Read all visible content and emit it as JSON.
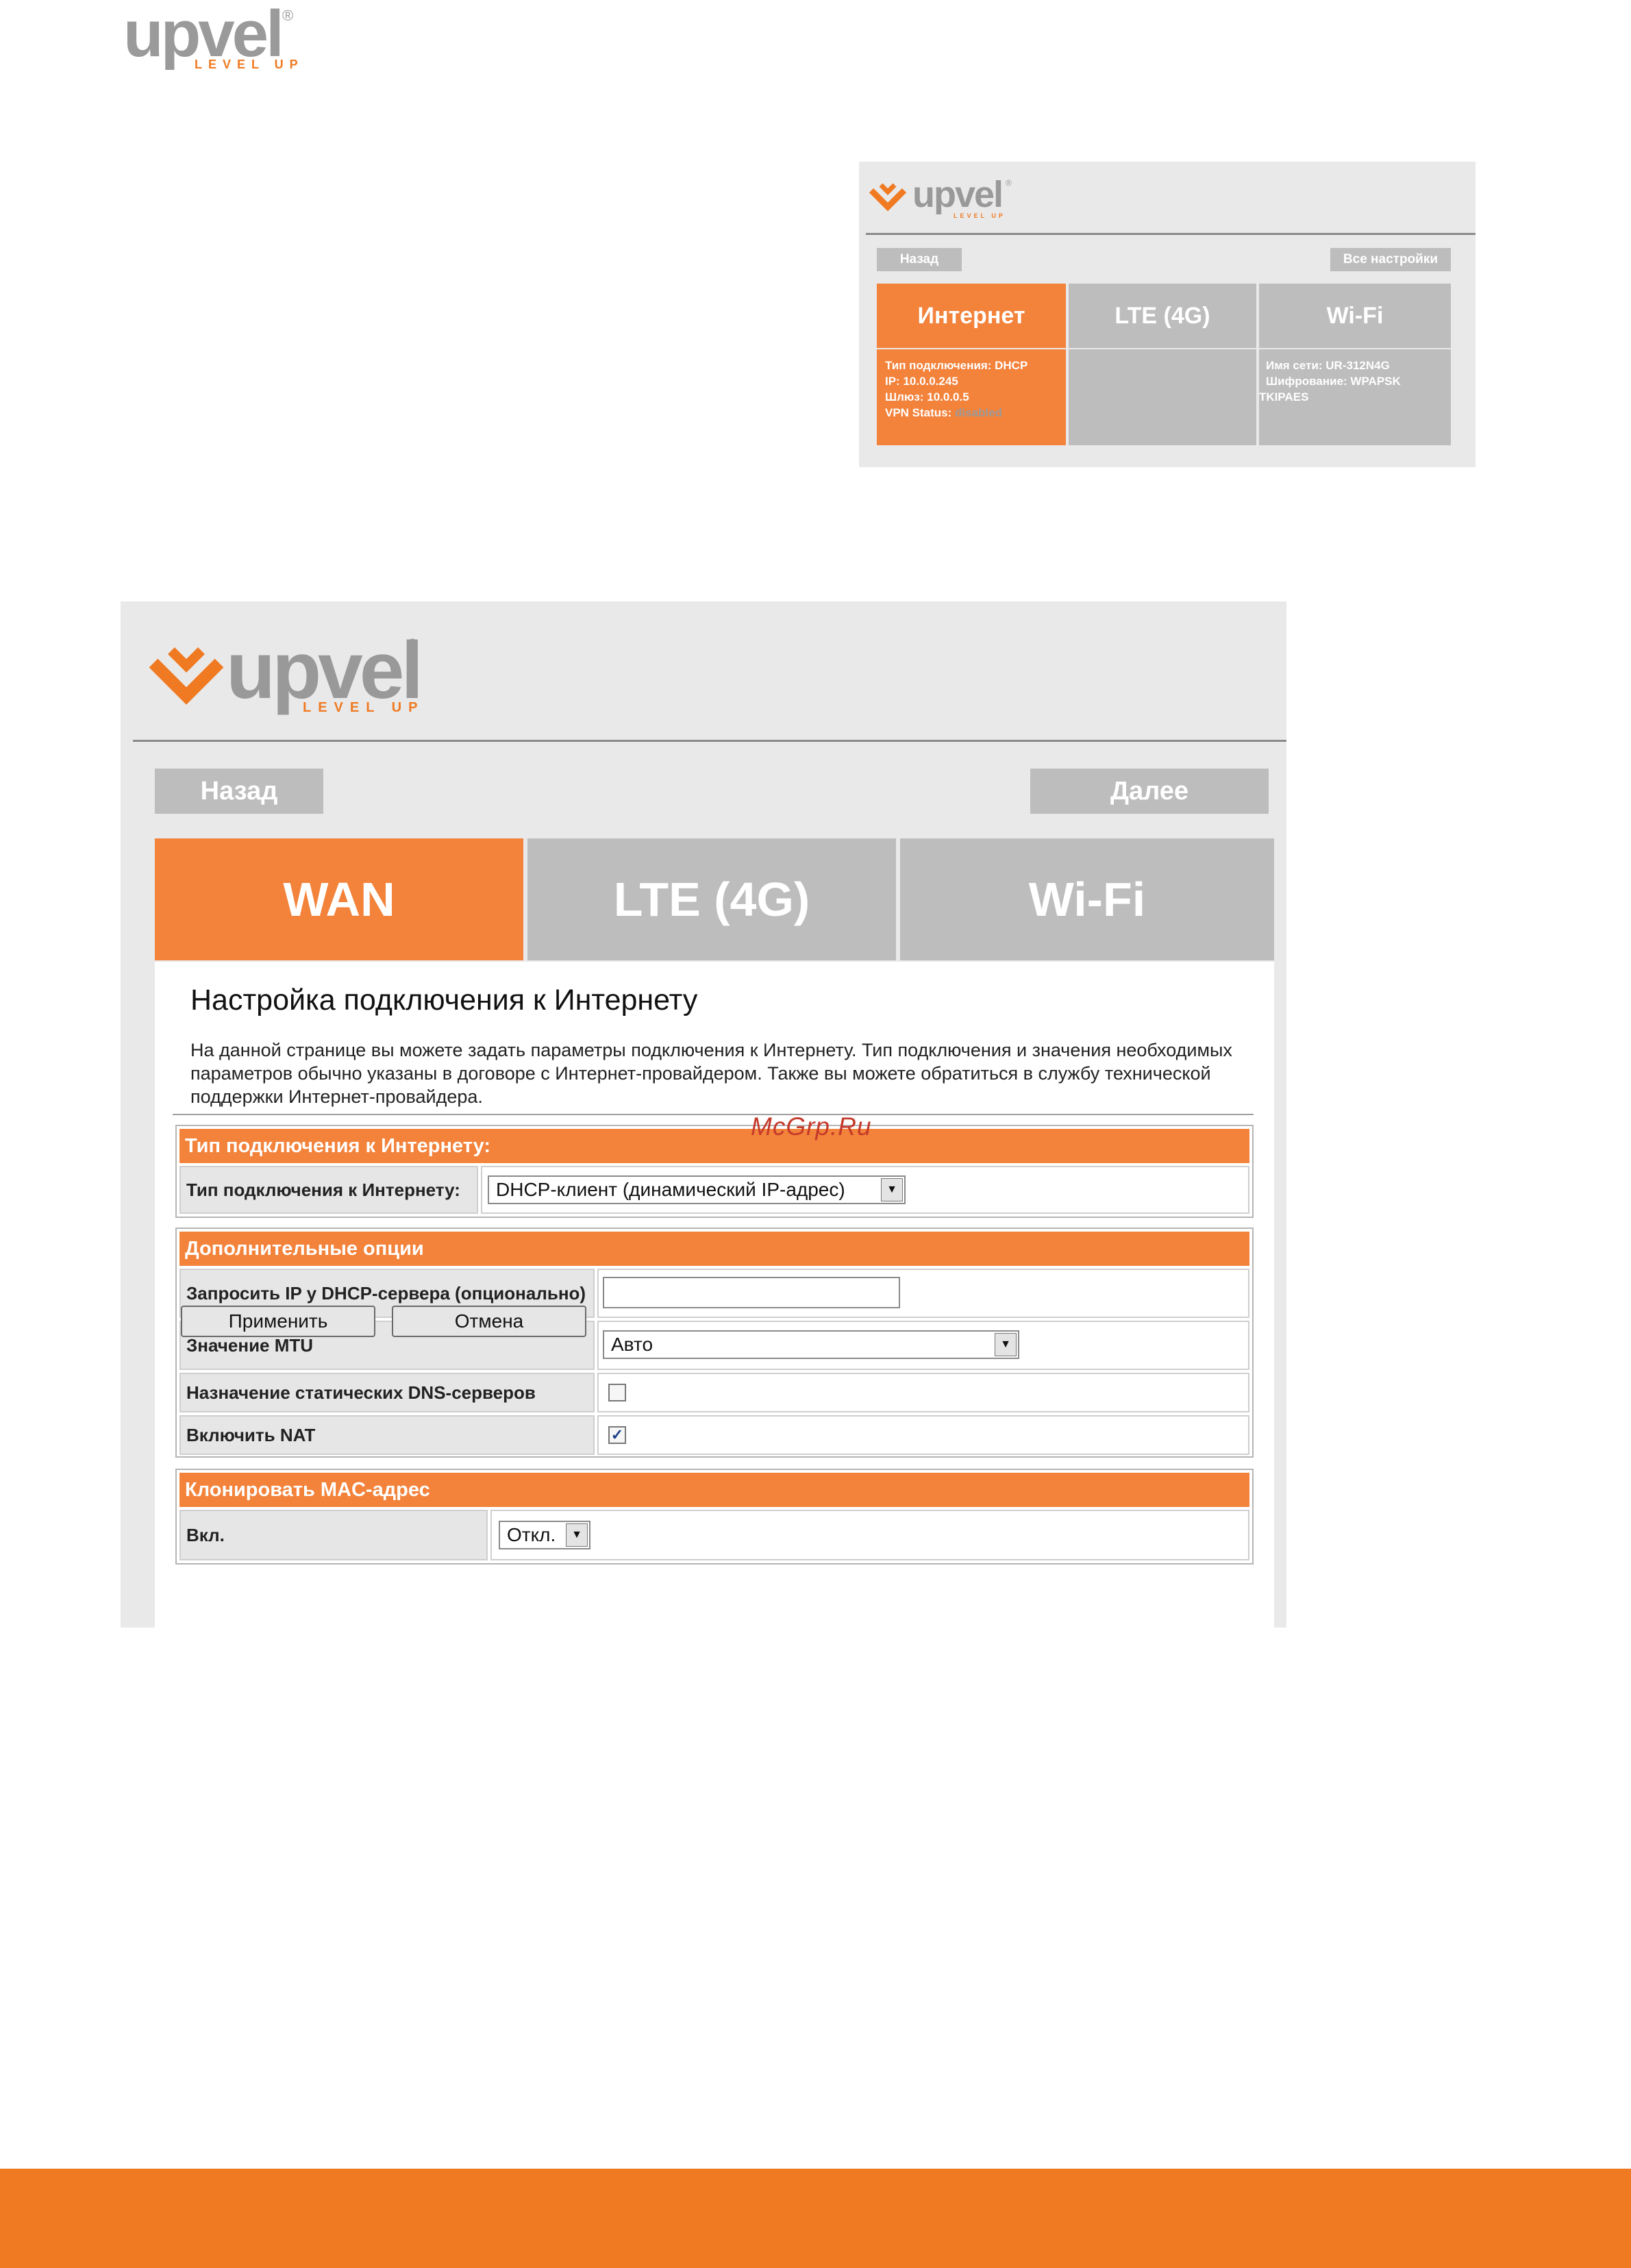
{
  "brand": {
    "name": "upvel",
    "reg": "®",
    "tagline": "LEVEL UP",
    "accent_color": "#f07a22"
  },
  "overview_screen": {
    "back_button": "Назад",
    "all_settings_button": "Все настройки",
    "tiles": [
      {
        "label": "Интернет",
        "active": true
      },
      {
        "label": "LTE (4G)",
        "active": false
      },
      {
        "label": "Wi-Fi",
        "active": false
      }
    ],
    "internet_info": {
      "type": "Тип подключения: DHCP",
      "ip": "IP: 10.0.0.245",
      "gateway": "Шлюз: 10.0.0.5",
      "vpn_label": "VPN Status:",
      "vpn_value": "disabled"
    },
    "wifi_info": {
      "ssid": "Имя сети: UR-312N4G",
      "encryption": "Шифрование: WPAPSK",
      "encryption_cont": "TKIPAES"
    }
  },
  "wan_screen": {
    "back_button": "Назад",
    "next_button": "Далее",
    "tabs": [
      {
        "label": "WAN",
        "active": true
      },
      {
        "label": "LTE (4G)",
        "active": false
      },
      {
        "label": "Wi-Fi",
        "active": false
      }
    ],
    "title": "Настройка подключения к Интернету",
    "description": "На данной странице вы можете задать параметры подключения к Интернету. Тип подключения и значения необходимых параметров обычно указаны в договоре с Интернет-провайдером. Также вы можете обратиться в службу технической поддержки Интернет-провайдера.",
    "section_connection": {
      "header": "Тип подключения к Интернету:",
      "type_label": "Тип подключения к Интернету:",
      "type_value": "DHCP-клиент (динамический IP-адрес)"
    },
    "section_options": {
      "header": "Дополнительные опции",
      "request_ip_label": "Запросить IP у DHCP-сервера (опционально)",
      "request_ip_value": "",
      "mtu_label": "Значение MTU",
      "mtu_value": "Авто",
      "static_dns_label": "Назначение статических DNS-серверов",
      "static_dns_checked": false,
      "nat_label": "Включить NAT",
      "nat_checked": true
    },
    "section_mac": {
      "header": "Клонировать MAC-адрес",
      "enable_label": "Вкл.",
      "enable_value": "Откл."
    },
    "apply_button": "Применить",
    "cancel_button": "Отмена"
  },
  "watermark": "McGrp.Ru",
  "checkmark": "✓",
  "dropdown_arrow": "▼"
}
